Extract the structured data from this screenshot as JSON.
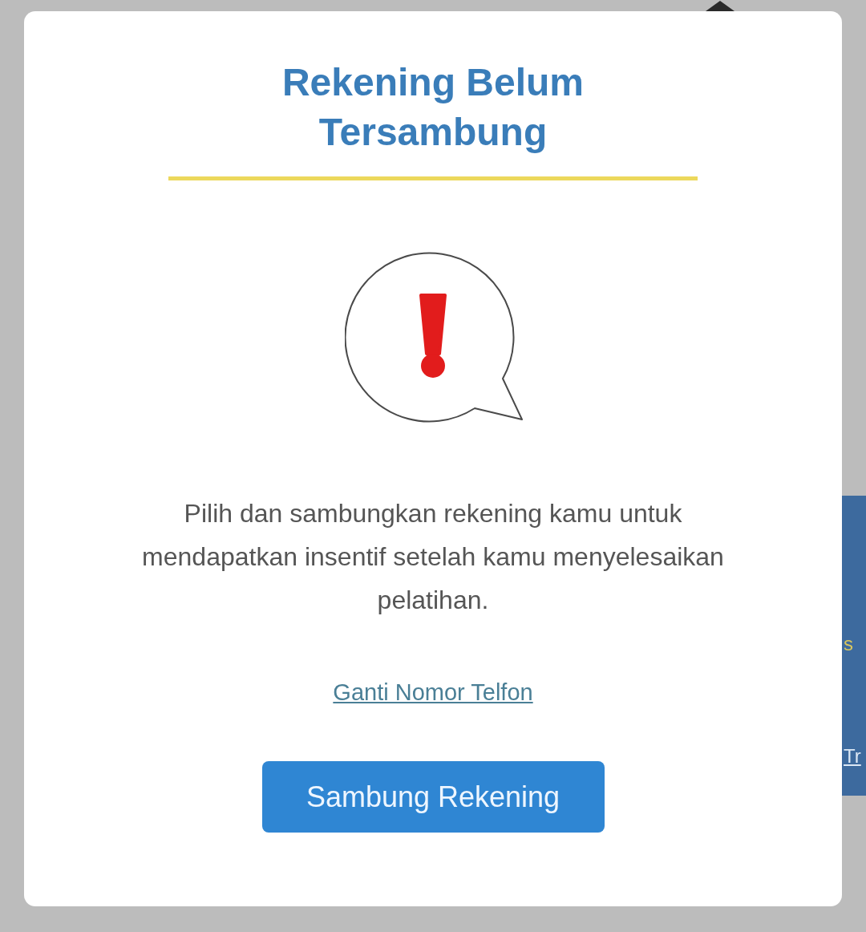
{
  "background": {
    "panel_texts": [
      {
        "text": "s",
        "kind": "plain"
      },
      {
        "text": "Tr",
        "kind": "link"
      }
    ]
  },
  "dialog": {
    "title": "Rekening Belum Tersambung",
    "message": "Pilih dan sambungkan rekening kamu untuk mendapatkan insentif setelah kamu menyelesaikan pelatihan.",
    "link": "Ganti Nomor Telfon",
    "button": "Sambung Rekening"
  }
}
